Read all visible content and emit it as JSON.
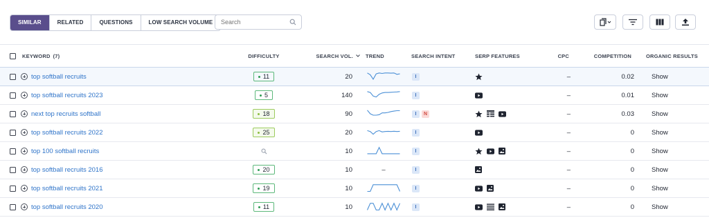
{
  "toolbar": {
    "tabs": [
      "SIMILAR",
      "RELATED",
      "QUESTIONS",
      "LOW SEARCH VOLUME"
    ],
    "active_tab": "SIMILAR",
    "search_placeholder": "Search",
    "tools": [
      "copy-icon",
      "filter-icon",
      "columns-icon",
      "export-icon"
    ]
  },
  "table": {
    "headers": {
      "keyword": "KEYWORD",
      "keyword_count": "(7)",
      "difficulty": "DIFFICULTY",
      "search_volume": "SEARCH VOL.",
      "trend": "TREND",
      "search_intent": "SEARCH INTENT",
      "serp_features": "SERP FEATURES",
      "cpc": "CPC",
      "competition": "COMPETITION",
      "organic_results": "ORGANIC RESULTS"
    },
    "rows": [
      {
        "keyword": "top softball recruits",
        "difficulty": "11",
        "volume": "20",
        "trend": [
          0.9,
          0.7,
          0.2,
          0.8,
          0.9,
          0.85,
          0.9,
          0.9,
          0.88,
          0.9,
          0.75,
          0.8
        ],
        "intent": [
          "I"
        ],
        "features": [
          "star-icon"
        ],
        "cpc": "–",
        "competition": "0.02",
        "organic": "Show"
      },
      {
        "keyword": "top softball recruits 2023",
        "difficulty": "5",
        "volume": "140",
        "trend": [
          0.9,
          0.8,
          0.4,
          0.3,
          0.6,
          0.75,
          0.8,
          0.8,
          0.82,
          0.85,
          0.86,
          0.9
        ],
        "intent": [
          "I"
        ],
        "features": [
          "youtube-icon"
        ],
        "cpc": "–",
        "competition": "0.01",
        "organic": "Show"
      },
      {
        "keyword": "next top recruits softball",
        "difficulty": "18",
        "volume": "90",
        "trend": [
          0.9,
          0.5,
          0.35,
          0.35,
          0.4,
          0.6,
          0.6,
          0.65,
          0.75,
          0.8,
          0.85,
          0.85
        ],
        "intent": [
          "I",
          "N"
        ],
        "features": [
          "star-icon",
          "table-icon",
          "youtube-icon"
        ],
        "cpc": "–",
        "competition": "0.03",
        "organic": "Show"
      },
      {
        "keyword": "top softball recruits 2022",
        "difficulty": "25",
        "volume": "20",
        "trend": [
          0.7,
          0.6,
          0.3,
          0.6,
          0.7,
          0.55,
          0.6,
          0.62,
          0.6,
          0.63,
          0.6,
          0.62
        ],
        "intent": [
          "I"
        ],
        "features": [
          "youtube-icon"
        ],
        "cpc": "–",
        "competition": "0",
        "organic": "Show"
      },
      {
        "keyword": "top 100 softball recruits",
        "difficulty": "",
        "volume": "10",
        "trend": [
          0.2,
          0.2,
          0.2,
          0.2,
          0.9,
          0.2,
          0.2,
          0.2,
          0.2,
          0.2,
          0.2,
          0.2
        ],
        "intent": [
          "I"
        ],
        "features": [
          "star-icon",
          "youtube-icon",
          "image-icon"
        ],
        "cpc": "–",
        "competition": "0",
        "organic": "Show"
      },
      {
        "keyword": "top softball recruits 2016",
        "difficulty": "20",
        "volume": "10",
        "trend_text": "–",
        "intent": [
          "I"
        ],
        "features": [
          "image-icon"
        ],
        "cpc": "–",
        "competition": "0",
        "organic": "Show"
      },
      {
        "keyword": "top softball recruits 2021",
        "difficulty": "19",
        "volume": "10",
        "trend": [
          0.15,
          0.15,
          0.9,
          0.9,
          0.9,
          0.9,
          0.9,
          0.9,
          0.9,
          0.9,
          0.9,
          0.15
        ],
        "intent": [
          "I"
        ],
        "features": [
          "youtube-icon",
          "image-icon"
        ],
        "cpc": "–",
        "competition": "0",
        "organic": "Show"
      },
      {
        "keyword": "top softball recruits 2020",
        "difficulty": "11",
        "volume": "10",
        "trend": [
          0.15,
          0.9,
          0.9,
          0.15,
          0.15,
          0.9,
          0.15,
          0.9,
          0.15,
          0.9,
          0.15,
          0.9
        ],
        "intent": [
          "I"
        ],
        "features": [
          "youtube-icon",
          "list-icon",
          "image-icon"
        ],
        "cpc": "–",
        "competition": "0",
        "organic": "Show"
      }
    ]
  },
  "colors": {
    "accent": "#5a4e8c",
    "link": "#2f74c9",
    "trend_line": "#4a8fd6",
    "difficulty_border": "#5cb87a"
  }
}
